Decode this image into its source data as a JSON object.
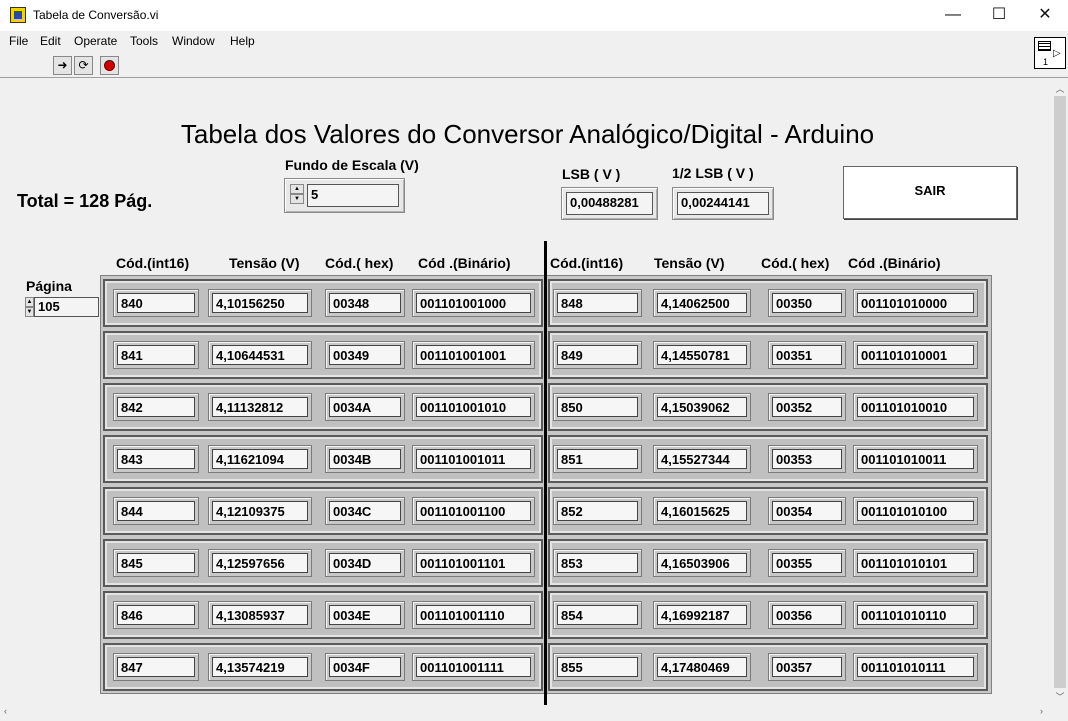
{
  "window": {
    "title": "Tabela de Conversão.vi",
    "minimize": "—",
    "maximize": "☐",
    "close": "✕"
  },
  "menu": [
    "File",
    "Edit",
    "Operate",
    "Tools",
    "Window",
    "Help"
  ],
  "vi_icon_number": "1",
  "panel": {
    "title": "Tabela dos Valores do Conversor Analógico/Digital - Arduino",
    "total_label": "Total = 128 Pág.",
    "fundo_label": "Fundo de Escala (V)",
    "fundo_value": "5",
    "lsb_label": "LSB   ( V )",
    "lsb_value": "0,00488281",
    "half_lsb_label": "1/2 LSB   ( V )",
    "half_lsb_value": "0,00244141",
    "sair_label": "SAIR",
    "pagina_label": "Página",
    "pagina_value": "105"
  },
  "columns": [
    "Cód.(int16)",
    "Tensão (V)",
    "Cód.( hex)",
    "Cód .(Binário)"
  ],
  "table_left": [
    [
      "840",
      "4,10156250",
      "00348",
      "001101001000"
    ],
    [
      "841",
      "4,10644531",
      "00349",
      "001101001001"
    ],
    [
      "842",
      "4,11132812",
      "0034A",
      "001101001010"
    ],
    [
      "843",
      "4,11621094",
      "0034B",
      "001101001011"
    ],
    [
      "844",
      "4,12109375",
      "0034C",
      "001101001100"
    ],
    [
      "845",
      "4,12597656",
      "0034D",
      "001101001101"
    ],
    [
      "846",
      "4,13085937",
      "0034E",
      "001101001110"
    ],
    [
      "847",
      "4,13574219",
      "0034F",
      "001101001111"
    ]
  ],
  "table_right": [
    [
      "848",
      "4,14062500",
      "00350",
      "001101010000"
    ],
    [
      "849",
      "4,14550781",
      "00351",
      "001101010001"
    ],
    [
      "850",
      "4,15039062",
      "00352",
      "001101010010"
    ],
    [
      "851",
      "4,15527344",
      "00353",
      "001101010011"
    ],
    [
      "852",
      "4,16015625",
      "00354",
      "001101010100"
    ],
    [
      "853",
      "4,16503906",
      "00355",
      "001101010101"
    ],
    [
      "854",
      "4,16992187",
      "00356",
      "001101010110"
    ],
    [
      "855",
      "4,17480469",
      "00357",
      "001101010111"
    ]
  ]
}
